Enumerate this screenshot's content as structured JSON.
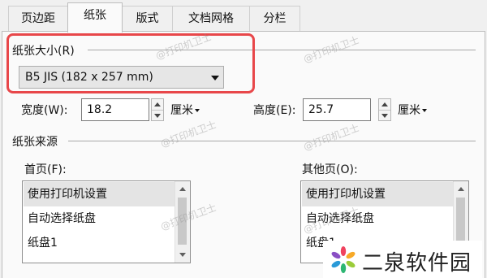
{
  "tabs": [
    {
      "label": "页边距",
      "active": false
    },
    {
      "label": "纸张",
      "active": true
    },
    {
      "label": "版式",
      "active": false
    },
    {
      "label": "文档网格",
      "active": false
    },
    {
      "label": "分栏",
      "active": false
    }
  ],
  "paper_size": {
    "label": "纸张大小(R)",
    "selected": "B5 JIS (182 x 257 mm)"
  },
  "width": {
    "label": "宽度(W):",
    "value": "18.2",
    "unit": "厘米"
  },
  "height": {
    "label": "高度(E):",
    "value": "25.7",
    "unit": "厘米"
  },
  "paper_source": {
    "label": "纸张来源",
    "first_page": {
      "label": "首页(F):",
      "items": [
        "使用打印机设置",
        "自动选择纸盘",
        "纸盘1"
      ],
      "selected_index": 0
    },
    "other_pages": {
      "label": "其他页(O):",
      "items": [
        "使用打印机设置",
        "自动选择纸盘",
        "纸盘1"
      ],
      "selected_index": 0
    }
  },
  "watermark": "@打印机卫士",
  "logo": {
    "text": "二泉软件园",
    "icon": "pinwheel-logo-icon"
  },
  "colors": {
    "highlight": "#e8474a"
  }
}
